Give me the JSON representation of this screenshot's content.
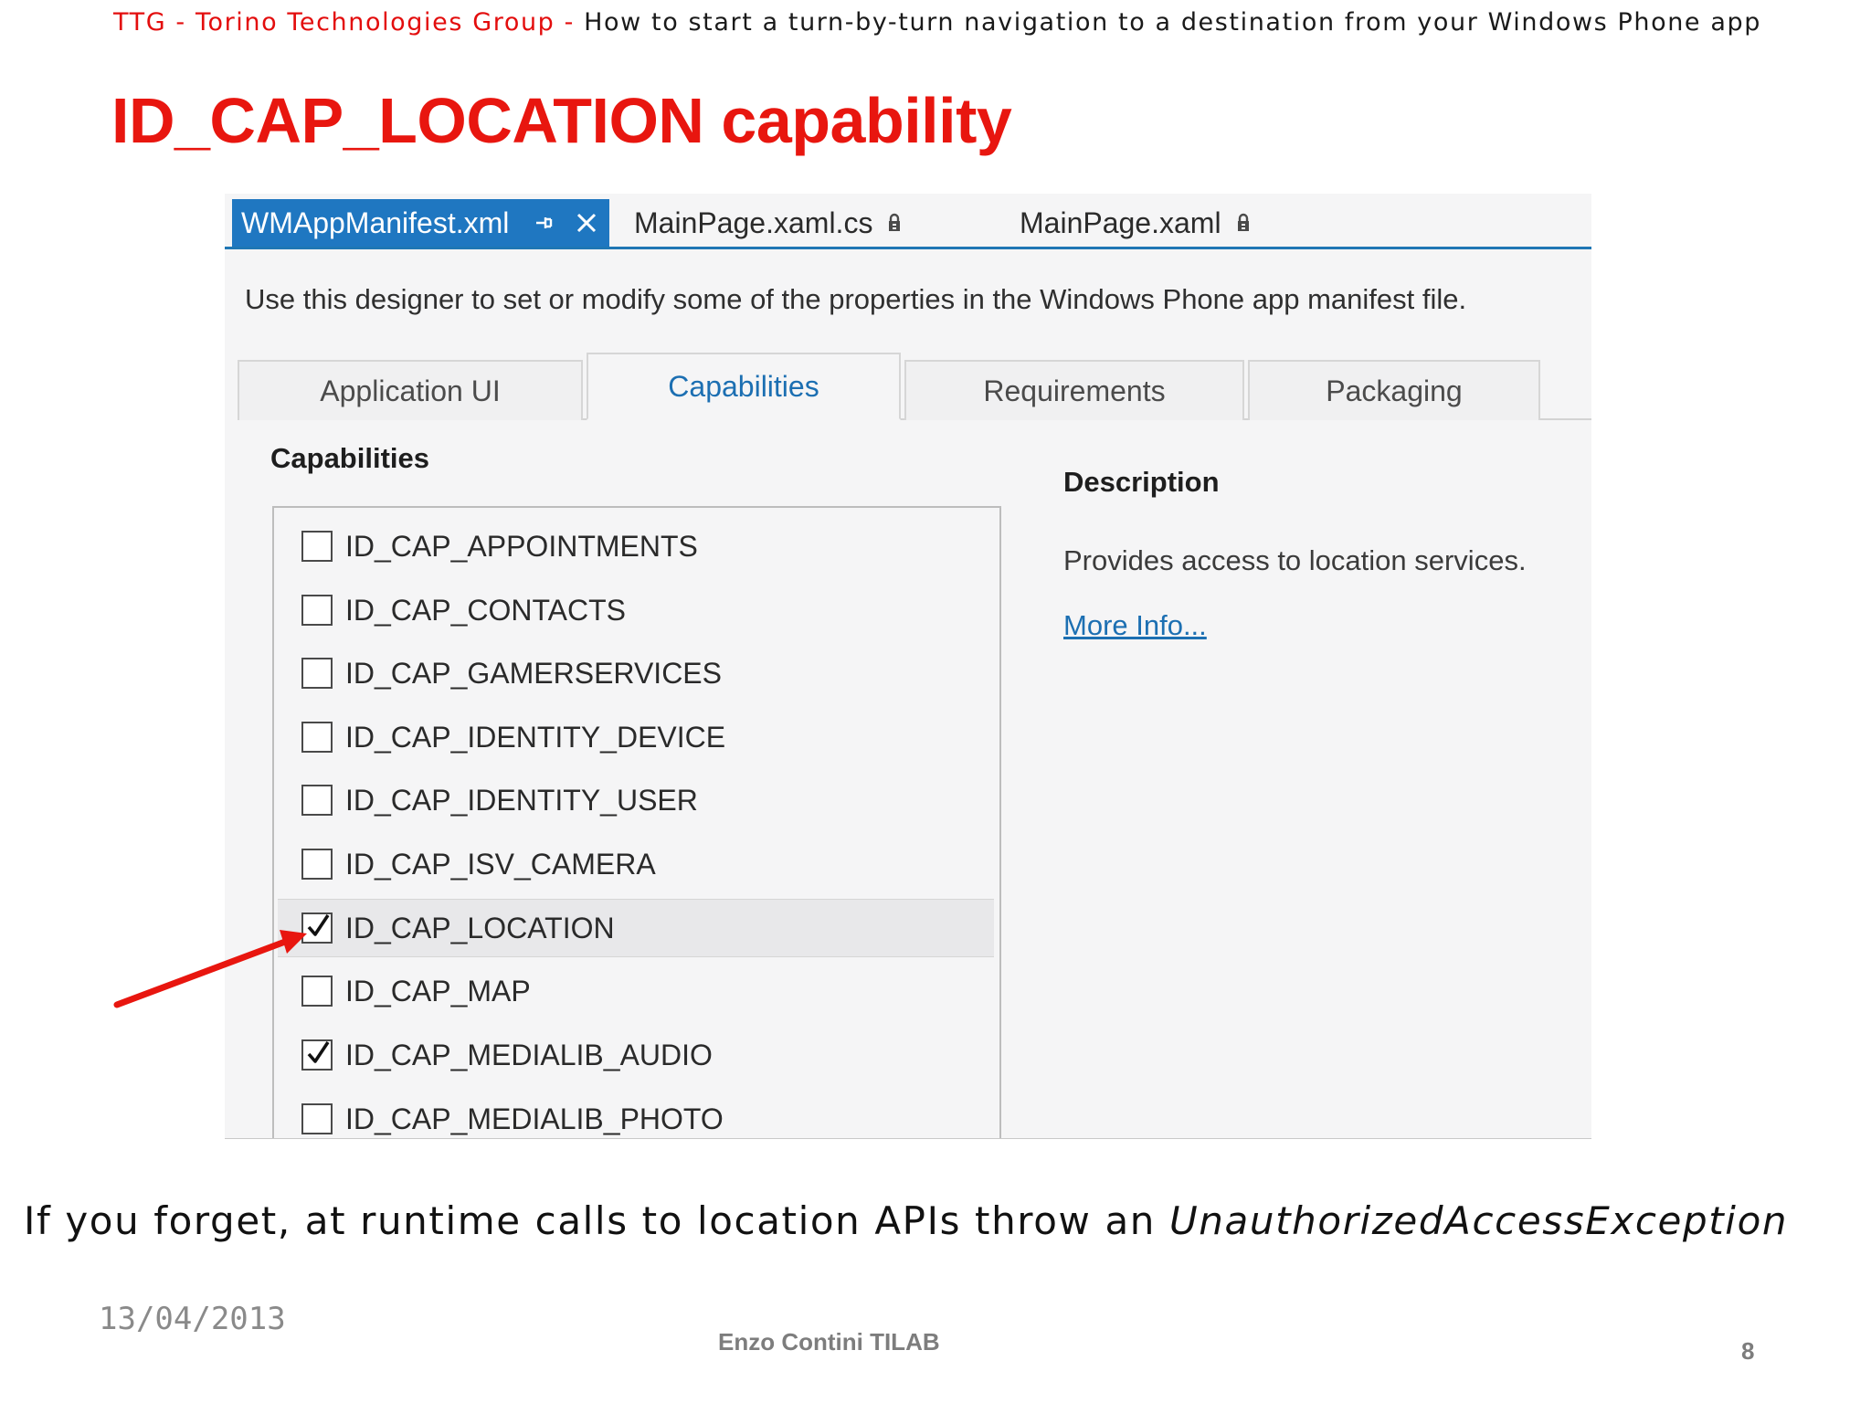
{
  "header": {
    "org": "TTG - Torino Technologies Group",
    "separator": " - ",
    "topic": "How to start a turn-by-turn navigation to a destination from your Windows Phone app"
  },
  "slide": {
    "title": "ID_CAP_LOCATION capability"
  },
  "editor": {
    "doc_tabs": [
      {
        "label": "WMAppManifest.xml",
        "active": true
      },
      {
        "label": "MainPage.xaml.cs",
        "active": false
      },
      {
        "label": "MainPage.xaml",
        "active": false
      }
    ],
    "designer_description": "Use this designer to set or modify some of the properties in the Windows Phone app manifest file.",
    "property_tabs": [
      {
        "label": "Application UI",
        "selected": false
      },
      {
        "label": "Capabilities",
        "selected": true
      },
      {
        "label": "Requirements",
        "selected": false
      },
      {
        "label": "Packaging",
        "selected": false
      }
    ],
    "capabilities_heading": "Capabilities",
    "capabilities": [
      {
        "label": "ID_CAP_APPOINTMENTS",
        "checked": false
      },
      {
        "label": "ID_CAP_CONTACTS",
        "checked": false
      },
      {
        "label": "ID_CAP_GAMERSERVICES",
        "checked": false
      },
      {
        "label": "ID_CAP_IDENTITY_DEVICE",
        "checked": false
      },
      {
        "label": "ID_CAP_IDENTITY_USER",
        "checked": false
      },
      {
        "label": "ID_CAP_ISV_CAMERA",
        "checked": false
      },
      {
        "label": "ID_CAP_LOCATION",
        "checked": true,
        "highlighted": true
      },
      {
        "label": "ID_CAP_MAP",
        "checked": false
      },
      {
        "label": "ID_CAP_MEDIALIB_AUDIO",
        "checked": true
      },
      {
        "label": "ID_CAP_MEDIALIB_PHOTO",
        "checked": false
      }
    ],
    "description_heading": "Description",
    "description_text": "Provides access to location services.",
    "more_info_link": "More Info...",
    "icons": {
      "pin": "pin-icon",
      "close": "close-icon",
      "lock": "lock-icon",
      "check": "checkmark-icon"
    }
  },
  "footnote": {
    "text": "If you forget, at runtime calls to location APIs throw an ",
    "exception": "UnauthorizedAccessException"
  },
  "footer": {
    "date": "13/04/2013",
    "author": "Enzo Contini TILAB",
    "page_number": "8"
  },
  "colors": {
    "accent_red": "#e8160f",
    "tab_active_blue": "#1f77c1",
    "link_blue": "#1c6fb2",
    "arrow_red": "#e8160f"
  }
}
